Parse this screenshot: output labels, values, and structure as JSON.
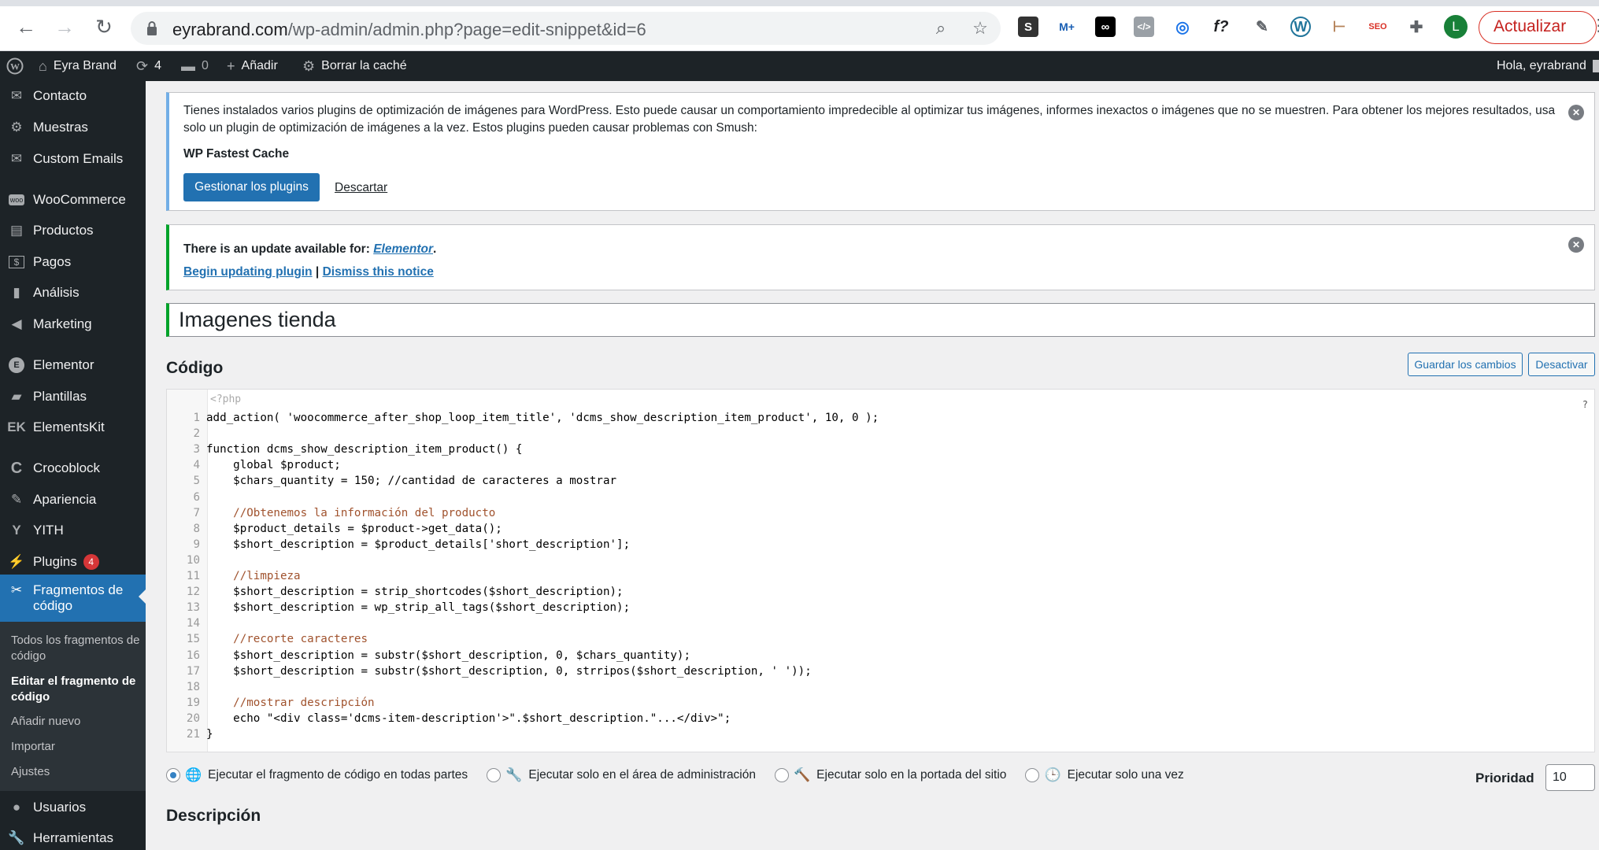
{
  "browser": {
    "url_domain": "eyrabrand.com",
    "url_path": "/wp-admin/admin.php?page=edit-snippet&id=6",
    "profile_initial": "L",
    "update_label": "Actualizar",
    "extensions": [
      "S",
      "M+",
      "∞",
      "</>",
      "◎",
      "f?",
      "✎",
      "W",
      "⊢",
      "SEO",
      "✚"
    ]
  },
  "adminbar": {
    "site_name": "Eyra Brand",
    "updates_count": "4",
    "comments_count": "0",
    "add_label": "Añadir",
    "cache_label": "Borrar la caché",
    "greeting": "Hola, eyrabrand"
  },
  "sidebar": {
    "items": [
      {
        "label": "Contacto",
        "icon": "mail-icon"
      },
      {
        "label": "Muestras",
        "icon": "gear-icon"
      },
      {
        "label": "Custom Emails",
        "icon": "mail-icon"
      },
      {
        "label": "WooCommerce",
        "icon": "woo-icon"
      },
      {
        "label": "Productos",
        "icon": "archive-icon"
      },
      {
        "label": "Pagos",
        "icon": "dollar-icon"
      },
      {
        "label": "Análisis",
        "icon": "chart-icon"
      },
      {
        "label": "Marketing",
        "icon": "megaphone-icon"
      },
      {
        "label": "Elementor",
        "icon": "elementor-icon"
      },
      {
        "label": "Plantillas",
        "icon": "folder-icon"
      },
      {
        "label": "ElementsKit",
        "icon": "ek-icon"
      },
      {
        "label": "Crocoblock",
        "icon": "crocoblock-icon"
      },
      {
        "label": "Apariencia",
        "icon": "brush-icon"
      },
      {
        "label": "YITH",
        "icon": "yith-icon"
      },
      {
        "label": "Plugins",
        "icon": "plug-icon",
        "badge": "4"
      },
      {
        "label": "Fragmentos de código",
        "icon": "scissors-icon"
      },
      {
        "label": "Usuarios",
        "icon": "user-icon"
      },
      {
        "label": "Herramientas",
        "icon": "wrench-icon"
      }
    ],
    "submenu": [
      "Todos los fragmentos de código",
      "Editar el fragmento de código",
      "Añadir nuevo",
      "Importar",
      "Ajustes"
    ]
  },
  "notice_smush": {
    "text": "Tienes instalados varios plugins de optimización de imágenes para WordPress. Esto puede causar un comportamiento impredecible al optimizar tus imágenes, informes inexactos o imágenes que no se muestren. Para obtener los mejores resultados, usa solo un plugin de optimización de imágenes a la vez. Estos plugins pueden causar problemas con Smush:",
    "plugin": "WP Fastest Cache",
    "manage_label": "Gestionar los plugins",
    "dismiss_label": "Descartar"
  },
  "notice_update": {
    "prefix": "There is an update available for:",
    "plugin": "Elementor",
    "begin_label": "Begin updating plugin",
    "separator": "|",
    "dismiss_label": "Dismiss this notice"
  },
  "snippet_title": "Imagenes tienda",
  "code_section": {
    "heading": "Código",
    "save_label": "Guardar los cambios",
    "deactivate_label": "Desactivar",
    "php_open": "<?php",
    "help": "?",
    "lines": [
      "add_action( 'woocommerce_after_shop_loop_item_title', 'dcms_show_description_item_product', 10, 0 );",
      "",
      "function dcms_show_description_item_product() {",
      "    global $product;",
      "    $chars_quantity = 150; //cantidad de caracteres a mostrar",
      "",
      "    //Obtenemos la información del producto",
      "    $product_details = $product->get_data();",
      "    $short_description = $product_details['short_description'];",
      "",
      "    //limpieza",
      "    $short_description = strip_shortcodes($short_description);",
      "    $short_description = wp_strip_all_tags($short_description);",
      "",
      "    //recorte caracteres",
      "    $short_description = substr($short_description, 0, $chars_quantity);",
      "    $short_description = substr($short_description, 0, strripos($short_description, ' '));",
      "",
      "    //mostrar descripción",
      "    echo \"<div class='dcms-item-description'>\".$short_description.\"...</div>\";",
      "}"
    ]
  },
  "scope_options": [
    {
      "label": "Ejecutar el fragmento de código en todas partes",
      "icon": "globe-icon",
      "checked": true
    },
    {
      "label": "Ejecutar solo en el área de administración",
      "icon": "wrench-icon",
      "checked": false
    },
    {
      "label": "Ejecutar solo en la portada del sitio",
      "icon": "hammer-icon",
      "checked": false
    },
    {
      "label": "Ejecutar solo una vez",
      "icon": "clock-icon",
      "checked": false
    }
  ],
  "priority": {
    "label": "Prioridad",
    "value": "10"
  },
  "description_heading": "Descripción"
}
